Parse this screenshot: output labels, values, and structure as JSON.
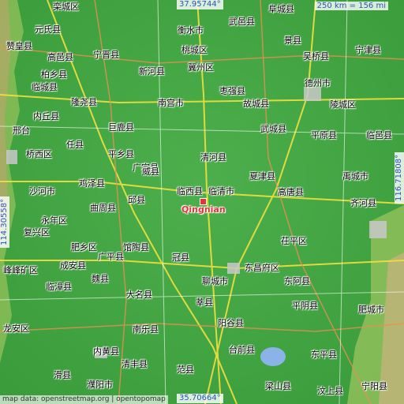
{
  "map": {
    "highlight": {
      "label": "Qingnian",
      "color": "#e8323a"
    },
    "coords": {
      "top": "37.95744°",
      "bottom": "35.70664°",
      "left": "114.30558°",
      "right": "116.71808°"
    },
    "scale": "250 km = 156 mi",
    "attribution": "map data: openstreetmap.org | opentopomap",
    "places": [
      "栾城区",
      "阜城县",
      "元氏县",
      "衡水市",
      "武邑县",
      "赞皇县",
      "高邑县",
      "宁晋县",
      "桃城区",
      "景县",
      "柏乡县",
      "新河县",
      "冀州区",
      "吴桥县",
      "宁津县",
      "临城县",
      "德州市",
      "隆尧县",
      "南宫市",
      "枣强县",
      "故城县",
      "陵城区",
      "内丘县",
      "巨鹿县",
      "武城县",
      "平原县",
      "邢台",
      "任县",
      "清河县",
      "临邑县",
      "桥西区",
      "平乡县",
      "夏津县",
      "禹城市",
      "广宗县",
      "沙河市",
      "鸡泽县",
      "威县",
      "临西县",
      "临清市",
      "高唐县",
      "齐河县",
      "永年区",
      "邱县",
      "曲周县",
      "馆陶县",
      "茌平区",
      "复兴区",
      "肥乡区",
      "广平县",
      "冠县",
      "东昌府区",
      "峰峰矿区",
      "成安县",
      "魏县",
      "聊城市",
      "东阿县",
      "临漳县",
      "大名县",
      "莘县",
      "平阴县",
      "龙安区",
      "南乐县",
      "阳谷县",
      "肥城市",
      "内黄县",
      "清丰县",
      "台前县",
      "东平县",
      "滑县",
      "濮阳市",
      "范县",
      "梁山县",
      "汶上县",
      "宁阳县"
    ]
  }
}
